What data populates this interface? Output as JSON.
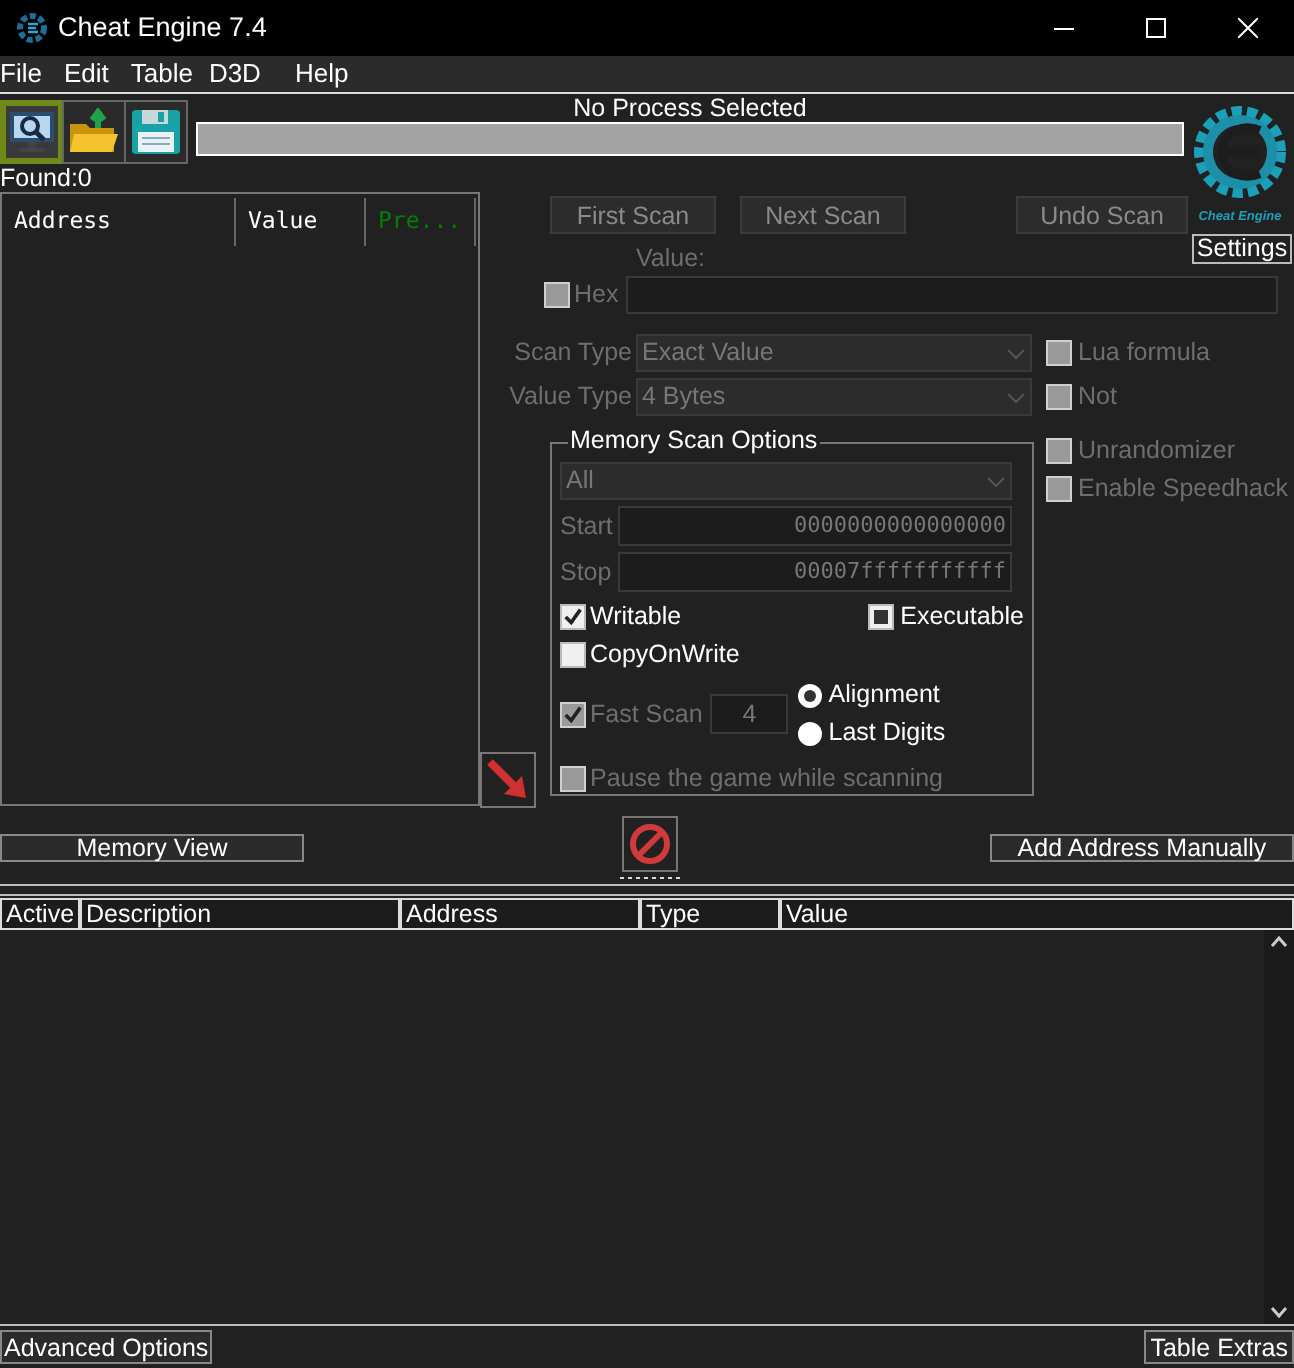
{
  "window": {
    "title": "Cheat Engine 7.4"
  },
  "menu": [
    {
      "label": "File"
    },
    {
      "label": "Edit"
    },
    {
      "label": "Table"
    },
    {
      "label": "D3D"
    },
    {
      "label": "Help"
    }
  ],
  "toolbar": [
    {
      "kind": "process",
      "selected": true
    },
    {
      "kind": "open",
      "selected": false
    },
    {
      "kind": "save",
      "selected": false
    }
  ],
  "process": {
    "title": "No Process Selected",
    "level": 0
  },
  "logo": {
    "caption": "Cheat Engine"
  },
  "settings_button": "Settings",
  "found": "Found:0",
  "results": {
    "columns": [
      {
        "label": "Address",
        "color": "#ffffff"
      },
      {
        "label": "Value",
        "color": "#ffffff"
      },
      {
        "label": "Pre...",
        "color": "#008000"
      }
    ]
  },
  "scan_buttons": [
    {
      "label": "First Scan"
    },
    {
      "label": "Next Scan"
    },
    {
      "label": "Undo Scan"
    }
  ],
  "value": {
    "label": "Value:",
    "hex": {
      "label": "Hex",
      "checked": false,
      "disabled": true
    }
  },
  "scan_type": {
    "label": "Scan Type",
    "value": "Exact Value"
  },
  "value_type": {
    "label": "Value Type",
    "value": "4 Bytes"
  },
  "scan_flags": [
    {
      "label": "Lua formula",
      "checked": false,
      "disabled": true
    },
    {
      "label": "Not",
      "checked": false,
      "disabled": true
    }
  ],
  "memory_scan_options": {
    "title": "Memory Scan Options",
    "region": "All",
    "start": {
      "label": "Start",
      "value": "0000000000000000"
    },
    "stop": {
      "label": "Stop",
      "value": "00007fffffffffff"
    },
    "flags": [
      {
        "label": "Writable",
        "checked": true
      },
      {
        "label": "Executable",
        "indeterminate": true
      },
      {
        "label": "CopyOnWrite",
        "checked": false
      }
    ],
    "fast_scan": {
      "label": "Fast Scan",
      "checked": true,
      "disabled": true,
      "value": "4"
    },
    "alignment": [
      {
        "label": "Alignment",
        "selected": true
      },
      {
        "label": "Last Digits",
        "selected": false
      }
    ],
    "pause": {
      "label": "Pause the game while scanning",
      "checked": false,
      "disabled": true
    }
  },
  "extras": [
    {
      "label": "Unrandomizer",
      "checked": false,
      "disabled": true
    },
    {
      "label": "Enable Speedhack",
      "checked": false,
      "disabled": true
    }
  ],
  "memory_view_button": "Memory View",
  "add_address_button": "Add Address Manually",
  "address_list": {
    "columns": [
      {
        "label": "Active"
      },
      {
        "label": "Description"
      },
      {
        "label": "Address"
      },
      {
        "label": "Type"
      },
      {
        "label": "Value"
      }
    ]
  },
  "footer": {
    "left": "Advanced Options",
    "right": "Table Extras"
  }
}
